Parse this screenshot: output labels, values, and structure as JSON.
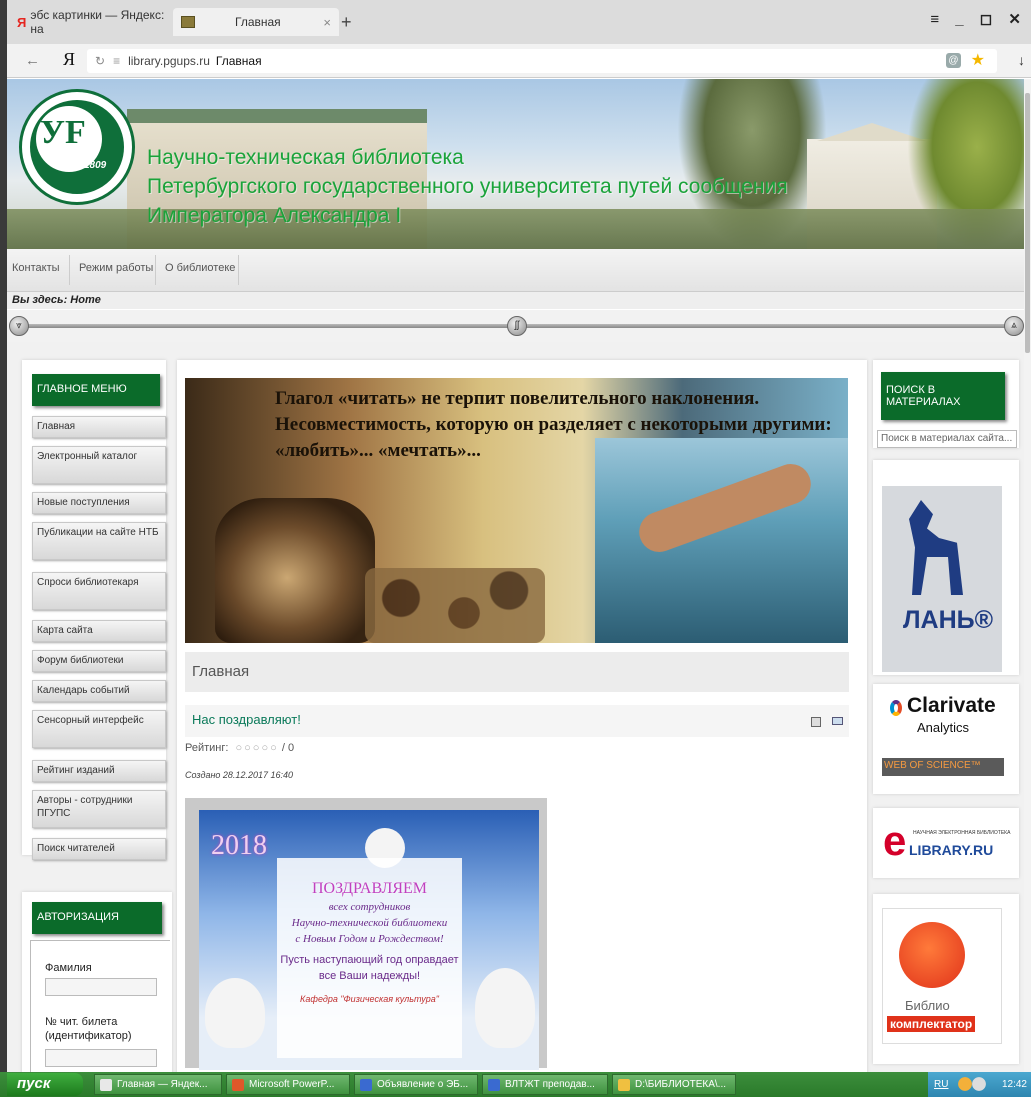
{
  "browser": {
    "tabs": [
      {
        "label": "эбс картинки — Яндекс: на",
        "brand": "Я"
      },
      {
        "label": "Главная",
        "close": "×"
      }
    ],
    "new_tab": "+",
    "window_controls": "≡ _ ◻ ✕",
    "address": {
      "back": "←",
      "yandex": "Я",
      "reload": "↻",
      "lock": "≡",
      "host": "library.pgups.ru",
      "title": "Главная",
      "download": "↓"
    }
  },
  "header": {
    "line1": "Научно-техническая библиотека",
    "line2": "Петербургского государственного университета путей сообщения",
    "line3": "Императора Александра I",
    "logo_year": "1809",
    "logo_letters": "УF"
  },
  "topnav": [
    "Контакты",
    "Режим работы",
    "О библиотеке"
  ],
  "breadcrumb": "Вы здесь: Home",
  "main_menu": {
    "title": "ГЛАВНОЕ МЕНЮ",
    "items": [
      "Главная",
      "Электронный каталог",
      "Новые поступления",
      "Публикации на сайте НТБ",
      "Спроси библиотекаря",
      "Карта сайта",
      "Форум библиотеки",
      "Календарь событий",
      "Сенсорный интерфейс",
      "Рейтинг изданий",
      "Авторы - сотрудники ПГУПС",
      "Поиск читателей"
    ]
  },
  "auth": {
    "title": "АВТОРИЗАЦИЯ",
    "surname_label": "Фамилия",
    "card_label": "№ чит. билета (идентификатор)"
  },
  "banner_quote": "Глагол «читать» не терпит повелительного наклонения. Несовместимость, которую он разделяет с некоторыми другими: «любить»... «мечтать»...",
  "page_heading": "Главная",
  "article": {
    "title": "Нас поздравляют!",
    "rating_label": "Рейтинг:",
    "rating_value": "0",
    "rating_stars": "○○○○○",
    "created": "Создано 28.12.2017 16:40",
    "card": {
      "year": "2018",
      "headline": "ПОЗДРАВЛЯЕМ",
      "line1": "всех сотрудников",
      "line2": "Научно-технической библиотеки",
      "line3": "с Новым Годом и Рождеством!",
      "wish": "Пусть наступающий год оправдает все Ваши надежды!",
      "signature": "Кафедра \"Физическая культура\""
    }
  },
  "search": {
    "title": "ПОИСК В МАТЕРИАЛАХ",
    "placeholder": "Поиск в материалах сайта..."
  },
  "partners": {
    "lan": "ЛАНЬ®",
    "clarivate_1": "Clarivate",
    "clarivate_2": "Analytics",
    "wos": "WEB OF SCIENCE™",
    "elib_small": "НАУЧНАЯ ЭЛЕКТРОННАЯ БИБЛИОТЕКА",
    "elib": "LIBRARY.RU",
    "biblio_1": "Библио",
    "biblio_2": "комплектатор"
  },
  "taskbar": {
    "start": "пуск",
    "items": [
      "Главная — Яндек...",
      "Microsoft PowerP...",
      "Объявление о ЭБ...",
      "ВЛТЖТ преподав...",
      "D:\\БИБЛИОТЕКА\\..."
    ],
    "lang": "RU",
    "clock": "12:42"
  }
}
